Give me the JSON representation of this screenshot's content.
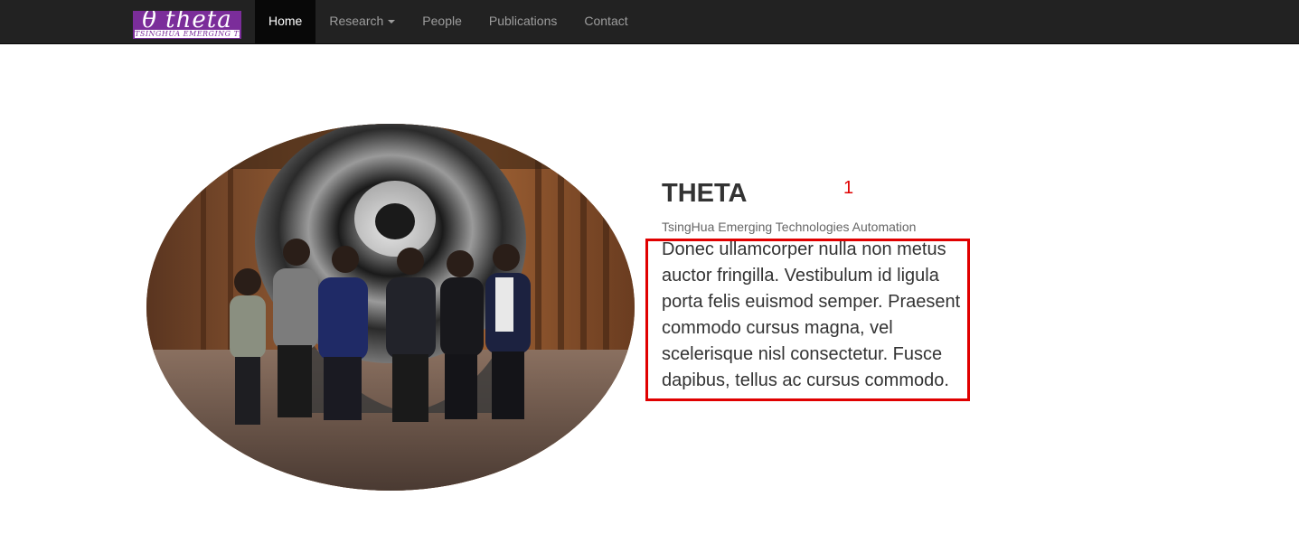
{
  "navbar": {
    "brand": {
      "main": "θ theta",
      "sub": "TSINGHUA EMERGING TECH"
    },
    "items": [
      {
        "label": "Home",
        "active": true
      },
      {
        "label": "Research",
        "dropdown": true
      },
      {
        "label": "People"
      },
      {
        "label": "Publications"
      },
      {
        "label": "Contact"
      }
    ]
  },
  "hero": {
    "title": "THETA",
    "marker": "1",
    "subtitle": "TsingHua Emerging Technologies Automation",
    "body": "Donec ullamcorper nulla non metus auctor fringilla. Vestibulum id ligula porta felis euismod semper. Praesent commodo cursus magna, vel scelerisque nisl consectetur. Fusce dapibus, tellus ac cursus commodo."
  },
  "colors": {
    "navbar_bg": "#222222",
    "nav_active_bg": "#080808",
    "brand_bg": "#7b2d9a",
    "highlight": "#e00000"
  }
}
